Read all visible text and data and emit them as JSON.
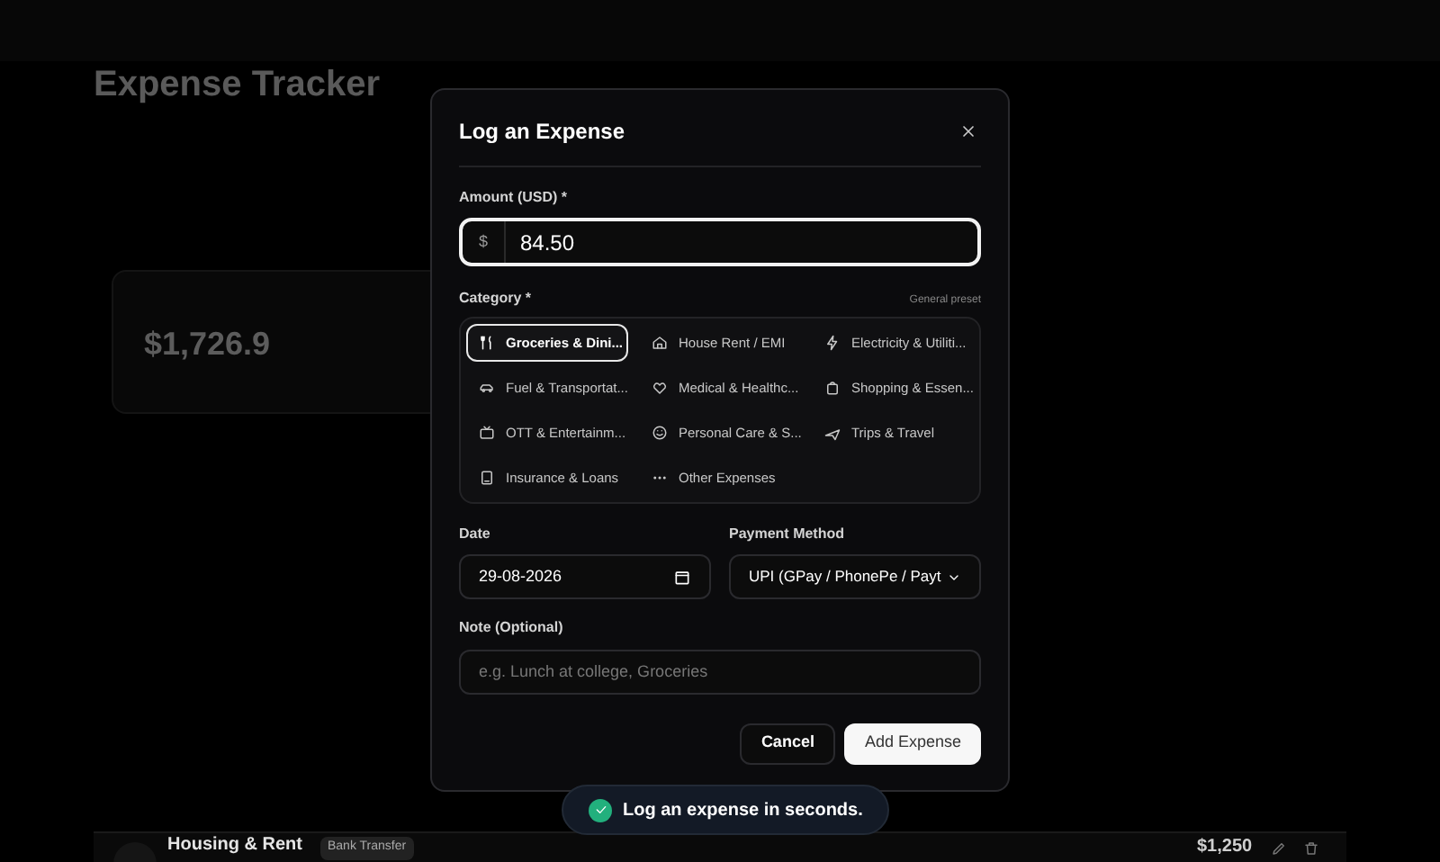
{
  "background": {
    "title": "Expense Tracker",
    "total": "$1,726.9",
    "transaction": {
      "name": "Housing & Rent",
      "method": "Bank Transfer",
      "amount": "$1,250"
    }
  },
  "dialog": {
    "title": "Log an Expense",
    "amount_label": "Amount (USD) *",
    "currency": "$",
    "amount": "84.50",
    "category_label": "Category *",
    "preset": "General preset",
    "categories": [
      {
        "label": "Groceries & Dini...",
        "selected": true
      },
      {
        "label": "House Rent / EMI",
        "selected": false
      },
      {
        "label": "Electricity & Utiliti...",
        "selected": false
      },
      {
        "label": "Fuel & Transportat...",
        "selected": false
      },
      {
        "label": "Medical & Healthc...",
        "selected": false
      },
      {
        "label": "Shopping & Essen...",
        "selected": false
      },
      {
        "label": "OTT & Entertainm...",
        "selected": false
      },
      {
        "label": "Personal Care & S...",
        "selected": false
      },
      {
        "label": "Trips & Travel",
        "selected": false
      },
      {
        "label": "Insurance & Loans",
        "selected": false
      },
      {
        "label": "Other Expenses",
        "selected": false
      }
    ],
    "date_label": "Date",
    "date": "29-08-2026",
    "payment_label": "Payment Method",
    "payment": "UPI (GPay / PhonePe / Payt",
    "note_label": "Note (Optional)",
    "note_placeholder": "e.g. Lunch at college, Groceries",
    "cancel": "Cancel",
    "submit": "Add Expense"
  },
  "toast": {
    "text": "Log an expense in seconds."
  }
}
